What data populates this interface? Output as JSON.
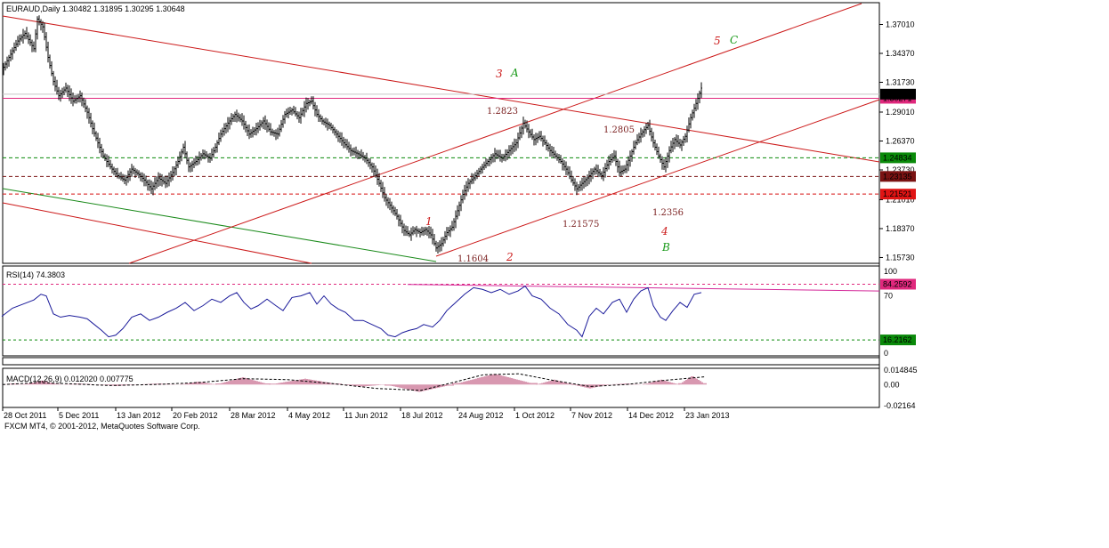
{
  "chart_data": {
    "type": "candlestick",
    "symbol_header": "EURAUD,Daily  1.30482 1.31895 1.30295 1.30648",
    "footer": "FXCM MT4, © 2001-2012, MetaQuotes Software Corp.",
    "x_labels": [
      "28 Oct 2011",
      "5 Dec 2011",
      "13 Jan 2012",
      "20 Feb 2012",
      "28 Mar 2012",
      "4 May 2012",
      "11 Jun 2012",
      "18 Jul 2012",
      "24 Aug 2012",
      "1 Oct 2012",
      "7 Nov 2012",
      "14 Dec 2012",
      "23 Jan 2013"
    ],
    "price_axis_labels": [
      "1.37010",
      "1.34370",
      "1.31730",
      "1.29010",
      "1.26370",
      "1.23730",
      "1.21010",
      "1.18370",
      "1.15730"
    ],
    "ylim": [
      1.152,
      1.39
    ],
    "price_path": [
      [
        0,
        1.325
      ],
      [
        10,
        1.34
      ],
      [
        20,
        1.355
      ],
      [
        28,
        1.362
      ],
      [
        38,
        1.348
      ],
      [
        42,
        1.375
      ],
      [
        48,
        1.368
      ],
      [
        54,
        1.34
      ],
      [
        60,
        1.318
      ],
      [
        66,
        1.305
      ],
      [
        74,
        1.312
      ],
      [
        82,
        1.3
      ],
      [
        90,
        1.305
      ],
      [
        98,
        1.29
      ],
      [
        104,
        1.275
      ],
      [
        110,
        1.262
      ],
      [
        116,
        1.25
      ],
      [
        124,
        1.24
      ],
      [
        132,
        1.232
      ],
      [
        140,
        1.228
      ],
      [
        148,
        1.238
      ],
      [
        156,
        1.233
      ],
      [
        162,
        1.228
      ],
      [
        170,
        1.22
      ],
      [
        178,
        1.23
      ],
      [
        186,
        1.225
      ],
      [
        194,
        1.235
      ],
      [
        200,
        1.245
      ],
      [
        206,
        1.258
      ],
      [
        212,
        1.24
      ],
      [
        220,
        1.245
      ],
      [
        228,
        1.252
      ],
      [
        236,
        1.248
      ],
      [
        242,
        1.258
      ],
      [
        248,
        1.27
      ],
      [
        256,
        1.28
      ],
      [
        264,
        1.288
      ],
      [
        272,
        1.282
      ],
      [
        280,
        1.27
      ],
      [
        288,
        1.275
      ],
      [
        296,
        1.282
      ],
      [
        304,
        1.272
      ],
      [
        312,
        1.27
      ],
      [
        320,
        1.288
      ],
      [
        328,
        1.292
      ],
      [
        336,
        1.285
      ],
      [
        344,
        1.298
      ],
      [
        350,
        1.3
      ],
      [
        356,
        1.288
      ],
      [
        362,
        1.282
      ],
      [
        370,
        1.278
      ],
      [
        378,
        1.27
      ],
      [
        386,
        1.262
      ],
      [
        394,
        1.255
      ],
      [
        402,
        1.252
      ],
      [
        410,
        1.248
      ],
      [
        418,
        1.24
      ],
      [
        426,
        1.225
      ],
      [
        432,
        1.212
      ],
      [
        438,
        1.205
      ],
      [
        446,
        1.195
      ],
      [
        454,
        1.182
      ],
      [
        460,
        1.178
      ],
      [
        466,
        1.183
      ],
      [
        472,
        1.18
      ],
      [
        478,
        1.183
      ],
      [
        484,
        1.178
      ],
      [
        490,
        1.166
      ],
      [
        496,
        1.17
      ],
      [
        502,
        1.18
      ],
      [
        508,
        1.185
      ],
      [
        514,
        1.2
      ],
      [
        520,
        1.215
      ],
      [
        526,
        1.225
      ],
      [
        532,
        1.23
      ],
      [
        540,
        1.238
      ],
      [
        548,
        1.245
      ],
      [
        556,
        1.252
      ],
      [
        564,
        1.248
      ],
      [
        572,
        1.255
      ],
      [
        580,
        1.262
      ],
      [
        588,
        1.28
      ],
      [
        594,
        1.272
      ],
      [
        600,
        1.265
      ],
      [
        606,
        1.268
      ],
      [
        612,
        1.262
      ],
      [
        618,
        1.255
      ],
      [
        624,
        1.25
      ],
      [
        630,
        1.245
      ],
      [
        636,
        1.238
      ],
      [
        642,
        1.228
      ],
      [
        648,
        1.22
      ],
      [
        654,
        1.225
      ],
      [
        660,
        1.23
      ],
      [
        668,
        1.238
      ],
      [
        676,
        1.232
      ],
      [
        684,
        1.245
      ],
      [
        690,
        1.25
      ],
      [
        696,
        1.235
      ],
      [
        702,
        1.238
      ],
      [
        708,
        1.25
      ],
      [
        714,
        1.262
      ],
      [
        720,
        1.27
      ],
      [
        728,
        1.278
      ],
      [
        734,
        1.262
      ],
      [
        740,
        1.25
      ],
      [
        746,
        1.24
      ],
      [
        752,
        1.255
      ],
      [
        758,
        1.265
      ],
      [
        764,
        1.26
      ],
      [
        770,
        1.268
      ],
      [
        776,
        1.285
      ],
      [
        782,
        1.298
      ],
      [
        788,
        1.312
      ]
    ],
    "horizontal_lines": [
      {
        "label": "1.30271",
        "value": 1.30271,
        "color": "#e0287d",
        "style": "solid",
        "label_bg": "#e0287d"
      },
      {
        "label": "1.24834",
        "value": 1.24834,
        "color": "#0a8a0a",
        "style": "dashed",
        "label_bg": "#0a8a0a"
      },
      {
        "label": "1.23135",
        "value": 1.23135,
        "color": "#7a1212",
        "style": "dashed",
        "label_bg": "#7a1212"
      },
      {
        "label": "1.21521",
        "value": 1.21521,
        "color": "#d81010",
        "style": "dashed",
        "label_bg": "#e01414"
      }
    ],
    "current_price_label": "1.30648",
    "annotations": [
      {
        "text": "1.2823",
        "value": 1.2823
      },
      {
        "text": "1.2805",
        "value": 1.2805
      },
      {
        "text": "1.21575",
        "value": 1.21575
      },
      {
        "text": "1.2356",
        "value": 1.2356
      },
      {
        "text": "1.1604",
        "value": 1.1604
      }
    ],
    "waves": [
      {
        "text": "1",
        "color": "#cc1a1a"
      },
      {
        "text": "2",
        "color": "#cc1a1a"
      },
      {
        "text": "3",
        "color": "#cc1a1a"
      },
      {
        "text": "A",
        "color": "#1a9a1a"
      },
      {
        "text": "4",
        "color": "#cc1a1a"
      },
      {
        "text": "B",
        "color": "#1a9a1a"
      },
      {
        "text": "5",
        "color": "#cc1a1a"
      },
      {
        "text": "C",
        "color": "#1a9a1a"
      }
    ],
    "rsi": {
      "header": "RSI(14) 74.3803",
      "axis_labels": [
        "100",
        "70",
        "0"
      ],
      "levels": [
        {
          "label": "84.2592",
          "value": 84.2592,
          "color": "#e0287d"
        },
        {
          "label": "16.2162",
          "value": 16.2162,
          "color": "#0a8a0a"
        }
      ],
      "path": [
        [
          0,
          45
        ],
        [
          12,
          55
        ],
        [
          24,
          60
        ],
        [
          36,
          65
        ],
        [
          44,
          72
        ],
        [
          50,
          70
        ],
        [
          58,
          48
        ],
        [
          66,
          44
        ],
        [
          76,
          46
        ],
        [
          88,
          44
        ],
        [
          96,
          42
        ],
        [
          104,
          35
        ],
        [
          112,
          28
        ],
        [
          120,
          20
        ],
        [
          128,
          22
        ],
        [
          136,
          30
        ],
        [
          146,
          44
        ],
        [
          156,
          48
        ],
        [
          166,
          40
        ],
        [
          176,
          44
        ],
        [
          186,
          50
        ],
        [
          196,
          55
        ],
        [
          206,
          62
        ],
        [
          216,
          52
        ],
        [
          226,
          58
        ],
        [
          236,
          66
        ],
        [
          246,
          62
        ],
        [
          256,
          70
        ],
        [
          264,
          74
        ],
        [
          272,
          62
        ],
        [
          280,
          54
        ],
        [
          288,
          58
        ],
        [
          298,
          66
        ],
        [
          308,
          58
        ],
        [
          316,
          52
        ],
        [
          326,
          68
        ],
        [
          336,
          70
        ],
        [
          346,
          74
        ],
        [
          354,
          60
        ],
        [
          362,
          70
        ],
        [
          370,
          60
        ],
        [
          378,
          54
        ],
        [
          386,
          50
        ],
        [
          396,
          40
        ],
        [
          406,
          40
        ],
        [
          416,
          35
        ],
        [
          426,
          30
        ],
        [
          434,
          22
        ],
        [
          442,
          20
        ],
        [
          450,
          25
        ],
        [
          458,
          28
        ],
        [
          466,
          30
        ],
        [
          474,
          35
        ],
        [
          484,
          32
        ],
        [
          492,
          40
        ],
        [
          500,
          52
        ],
        [
          510,
          62
        ],
        [
          520,
          72
        ],
        [
          530,
          80
        ],
        [
          540,
          78
        ],
        [
          550,
          74
        ],
        [
          560,
          78
        ],
        [
          570,
          72
        ],
        [
          580,
          76
        ],
        [
          588,
          82
        ],
        [
          596,
          70
        ],
        [
          606,
          66
        ],
        [
          616,
          55
        ],
        [
          626,
          48
        ],
        [
          636,
          35
        ],
        [
          646,
          28
        ],
        [
          652,
          20
        ],
        [
          660,
          45
        ],
        [
          668,
          55
        ],
        [
          676,
          48
        ],
        [
          686,
          62
        ],
        [
          694,
          66
        ],
        [
          702,
          50
        ],
        [
          710,
          66
        ],
        [
          718,
          76
        ],
        [
          726,
          80
        ],
        [
          732,
          58
        ],
        [
          740,
          44
        ],
        [
          746,
          40
        ],
        [
          754,
          52
        ],
        [
          762,
          62
        ],
        [
          770,
          56
        ],
        [
          778,
          72
        ],
        [
          786,
          74
        ]
      ],
      "ylim": [
        0,
        100
      ]
    },
    "macd": {
      "header": "MACD(12,26,9) 0.012020 0.007775",
      "axis_labels": [
        "0.014845",
        "0.00",
        "-0.02164"
      ],
      "ylim": [
        -0.0216,
        0.0148
      ],
      "histogram": [
        {
          "from": 0,
          "to": 24,
          "peak": 0.0012
        },
        {
          "from": 24,
          "to": 64,
          "peak": 0.004
        },
        {
          "from": 64,
          "to": 108,
          "peak": 0.001
        },
        {
          "from": 108,
          "to": 150,
          "peak": -0.0015
        },
        {
          "from": 150,
          "to": 200,
          "peak": 0.001
        },
        {
          "from": 200,
          "to": 240,
          "peak": 0.003
        },
        {
          "from": 240,
          "to": 300,
          "peak": 0.0075
        },
        {
          "from": 300,
          "to": 380,
          "peak": 0.006
        },
        {
          "from": 380,
          "to": 430,
          "peak": -0.002
        },
        {
          "from": 430,
          "to": 506,
          "peak": -0.0075
        },
        {
          "from": 506,
          "to": 600,
          "peak": 0.011
        },
        {
          "from": 600,
          "to": 640,
          "peak": 0.005
        },
        {
          "from": 640,
          "to": 680,
          "peak": -0.004
        },
        {
          "from": 680,
          "to": 720,
          "peak": 0.001
        },
        {
          "from": 720,
          "to": 760,
          "peak": 0.005
        },
        {
          "from": 760,
          "to": 790,
          "peak": 0.009
        }
      ],
      "signal_path": [
        [
          0,
          0.0
        ],
        [
          40,
          0.002
        ],
        [
          70,
          0.001
        ],
        [
          120,
          -0.001
        ],
        [
          170,
          0.0
        ],
        [
          220,
          0.002
        ],
        [
          270,
          0.006
        ],
        [
          320,
          0.005
        ],
        [
          370,
          0.001
        ],
        [
          420,
          -0.004
        ],
        [
          470,
          -0.006
        ],
        [
          510,
          0.003
        ],
        [
          540,
          0.01
        ],
        [
          580,
          0.011
        ],
        [
          620,
          0.004
        ],
        [
          660,
          -0.002
        ],
        [
          700,
          0.0
        ],
        [
          740,
          0.004
        ],
        [
          790,
          0.008
        ]
      ]
    }
  }
}
